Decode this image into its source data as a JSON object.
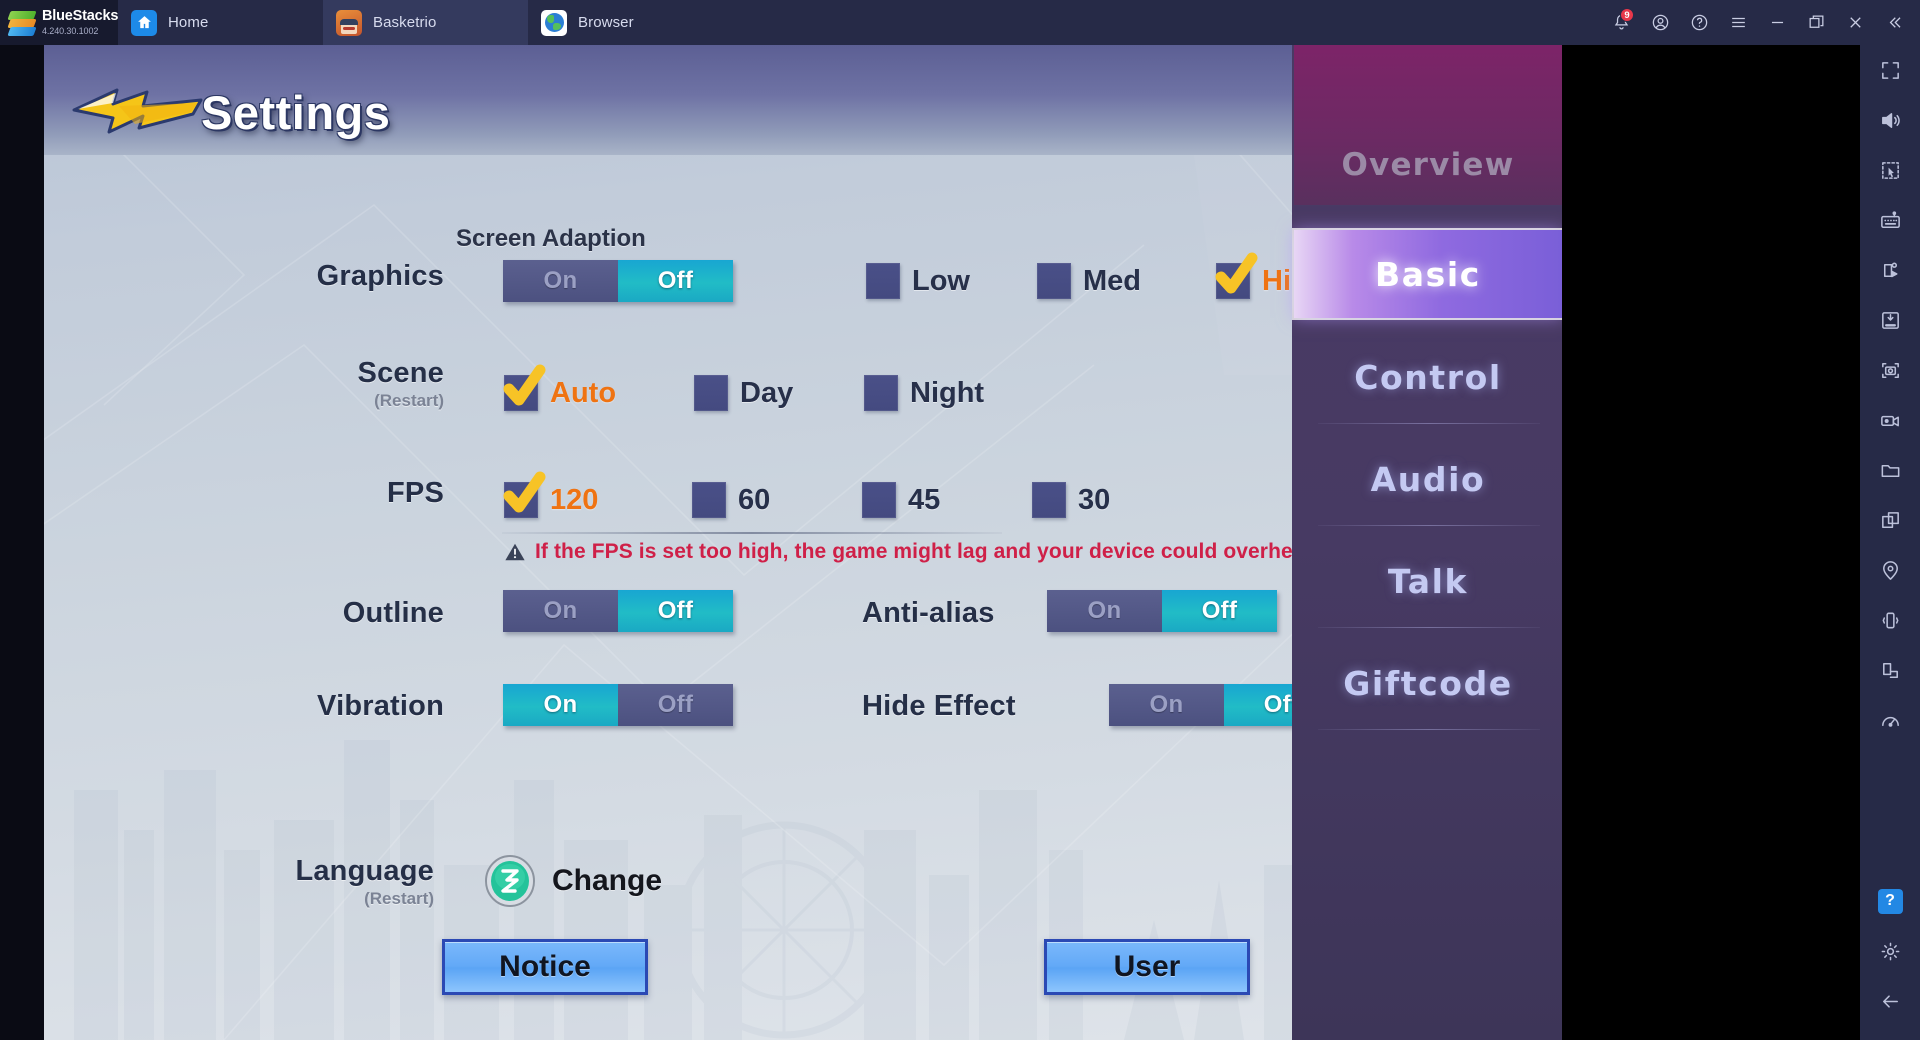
{
  "titlebar": {
    "brand": {
      "name": "BlueStacks",
      "version": "4.240.30.1002",
      "logo_icon": "bluestacks-logo"
    },
    "tabs": [
      {
        "label": "Home",
        "icon": "home-icon",
        "active": false
      },
      {
        "label": "Basketrio",
        "icon": "game-app-icon",
        "active": true
      },
      {
        "label": "Browser",
        "icon": "globe-icon",
        "active": false
      }
    ],
    "controls": [
      {
        "name": "notifications",
        "icon": "bell-icon",
        "badge": "9"
      },
      {
        "name": "account",
        "icon": "user-circle-icon",
        "badge": ""
      },
      {
        "name": "help",
        "icon": "question-circle-icon",
        "badge": ""
      },
      {
        "name": "menu",
        "icon": "hamburger-icon",
        "badge": ""
      },
      {
        "name": "minimize",
        "icon": "minimize-icon",
        "badge": ""
      },
      {
        "name": "maximize",
        "icon": "maximize-icon",
        "badge": ""
      },
      {
        "name": "close",
        "icon": "close-icon",
        "badge": ""
      },
      {
        "name": "collapse-sidebar",
        "icon": "double-chevron-left-icon",
        "badge": ""
      }
    ]
  },
  "game": {
    "page_title": "Settings",
    "back_icon": "yellow-back-arrow-icon",
    "screen_adaption_label": "Screen Adaption",
    "rows": {
      "graphics": {
        "label": "Graphics",
        "toggle": {
          "on": "On",
          "off": "Off",
          "value": "Off"
        },
        "quality": [
          {
            "label": "Low",
            "selected": false
          },
          {
            "label": "Med",
            "selected": false
          },
          {
            "label": "High",
            "selected": true
          }
        ]
      },
      "scene": {
        "label": "Scene",
        "sub": "(Restart)",
        "options": [
          {
            "label": "Auto",
            "selected": true
          },
          {
            "label": "Day",
            "selected": false
          },
          {
            "label": "Night",
            "selected": false
          }
        ]
      },
      "fps": {
        "label": "FPS",
        "options": [
          {
            "label": "120",
            "selected": true
          },
          {
            "label": "60",
            "selected": false
          },
          {
            "label": "45",
            "selected": false
          },
          {
            "label": "30",
            "selected": false
          }
        ],
        "warning": "If the FPS is set too high, the game might lag and your device could overheat",
        "warning_icon": "warning-triangle-icon"
      },
      "outline": {
        "label": "Outline",
        "toggle": {
          "on": "On",
          "off": "Off",
          "value": "Off"
        }
      },
      "antialias": {
        "label": "Anti-alias",
        "toggle": {
          "on": "On",
          "off": "Off",
          "value": "Off"
        }
      },
      "vibration": {
        "label": "Vibration",
        "toggle": {
          "on": "On",
          "off": "Off",
          "value": "On"
        }
      },
      "hide_effect": {
        "label": "Hide Effect",
        "toggle": {
          "on": "On",
          "off": "Off",
          "value": "Off"
        }
      },
      "language": {
        "label": "Language",
        "sub": "(Restart)",
        "change_label": "Change",
        "change_icon": "language-globe-icon"
      }
    },
    "bottom_buttons": [
      {
        "label": "Notice",
        "name": "notice-button"
      },
      {
        "label": "User",
        "name": "user-button"
      }
    ],
    "side_nav": {
      "header": "Overview",
      "items": [
        {
          "label": "Basic",
          "active": true
        },
        {
          "label": "Control",
          "active": false
        },
        {
          "label": "Audio",
          "active": false
        },
        {
          "label": "Talk",
          "active": false
        },
        {
          "label": "Giftcode",
          "active": false
        }
      ]
    }
  },
  "bs_toolbar": {
    "items": [
      "fullscreen-icon",
      "volume-icon",
      "multi-select-pointer-icon",
      "keyboard-controls-icon",
      "macro-script-icon",
      "apk-install-icon",
      "screenshot-icon",
      "record-video-icon",
      "media-folder-icon",
      "multi-instance-icon",
      "location-icon",
      "shake-icon",
      "rotate-icon",
      "performance-icon"
    ],
    "bottom_items": [
      "help-icon",
      "settings-gear-icon",
      "back-arrow-icon"
    ],
    "help_label": "?"
  },
  "colors": {
    "accent_cyan": "#1fb4cc",
    "toggle_off_bg": "#4f5486",
    "selected_orange": "#ef7312",
    "warning_red": "#cf2048",
    "button_blue": "#63a9f7",
    "sidebar_purple": "#473a63",
    "titlebar_bg": "#262a47"
  }
}
